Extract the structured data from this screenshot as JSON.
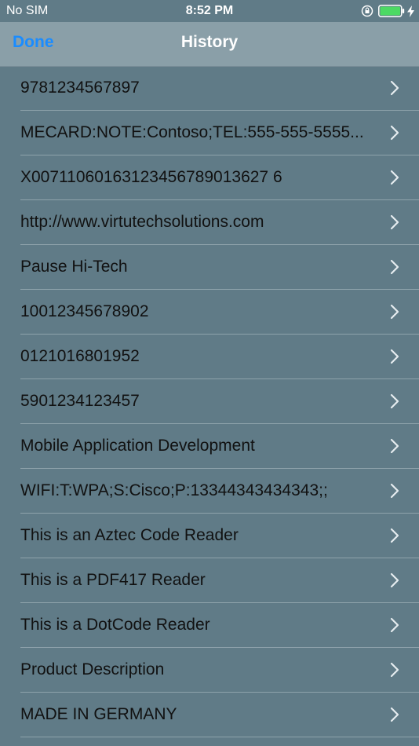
{
  "status_bar": {
    "carrier": "No SIM",
    "time": "8:52 PM"
  },
  "nav": {
    "done_label": "Done",
    "title": "History"
  },
  "history": {
    "items": [
      {
        "label": "9781234567897"
      },
      {
        "label": "MECARD:NOTE:Contoso;TEL:555-555-5555..."
      },
      {
        "label": "X00711060163123456789013627 6"
      },
      {
        "label": "http://www.virtutechsolutions.com"
      },
      {
        "label": "Pause Hi-Tech"
      },
      {
        "label": "10012345678902"
      },
      {
        "label": "0121016801952"
      },
      {
        "label": "5901234123457"
      },
      {
        "label": "Mobile Application Development"
      },
      {
        "label": "WIFI:T:WPA;S:Cisco;P:13344343434343;;"
      },
      {
        "label": "This is an Aztec Code Reader"
      },
      {
        "label": "This is a PDF417 Reader"
      },
      {
        "label": "This is a DotCode Reader"
      },
      {
        "label": "Product Description"
      },
      {
        "label": "MADE IN GERMANY"
      }
    ]
  },
  "colors": {
    "background": "#607b87",
    "nav_bar": "#8a9fa8",
    "accent": "#1a8cff",
    "battery": "#4cd964"
  },
  "icons": {
    "rotation_lock": "orientation-lock-icon",
    "battery": "battery-icon",
    "charging": "charging-bolt-icon",
    "disclosure": "chevron-right-icon"
  }
}
